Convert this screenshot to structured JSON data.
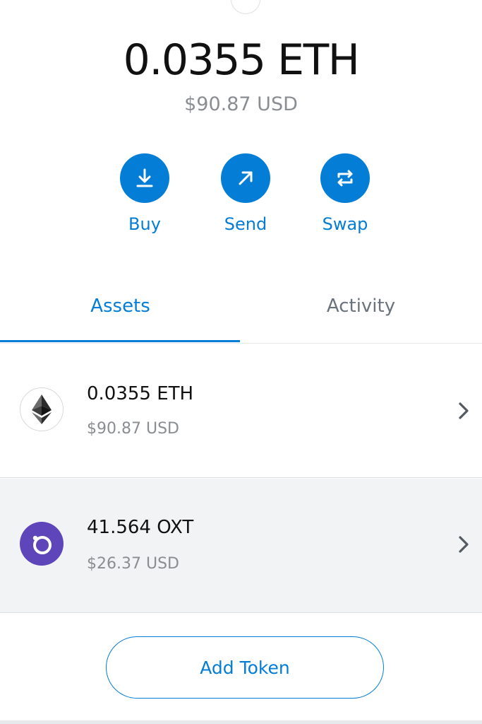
{
  "balance": {
    "primary": "0.0355 ETH",
    "secondary": "$90.87 USD"
  },
  "actions": [
    {
      "label": "Buy",
      "icon": "download-icon"
    },
    {
      "label": "Send",
      "icon": "arrow-up-right-icon"
    },
    {
      "label": "Swap",
      "icon": "swap-icon"
    }
  ],
  "tabs": [
    {
      "label": "Assets",
      "active": true
    },
    {
      "label": "Activity",
      "active": false
    }
  ],
  "assets": [
    {
      "amount": "0.0355 ETH",
      "fiat": "$90.87 USD",
      "icon": "ethereum-icon"
    },
    {
      "amount": "41.564 OXT",
      "fiat": "$26.37 USD",
      "icon": "orchid-icon"
    }
  ],
  "add_token_label": "Add Token",
  "colors": {
    "accent": "#037dd6",
    "oxt_brand": "#5f45ba",
    "muted_text": "#8a8d91",
    "row_highlight": "#f2f3f4"
  }
}
